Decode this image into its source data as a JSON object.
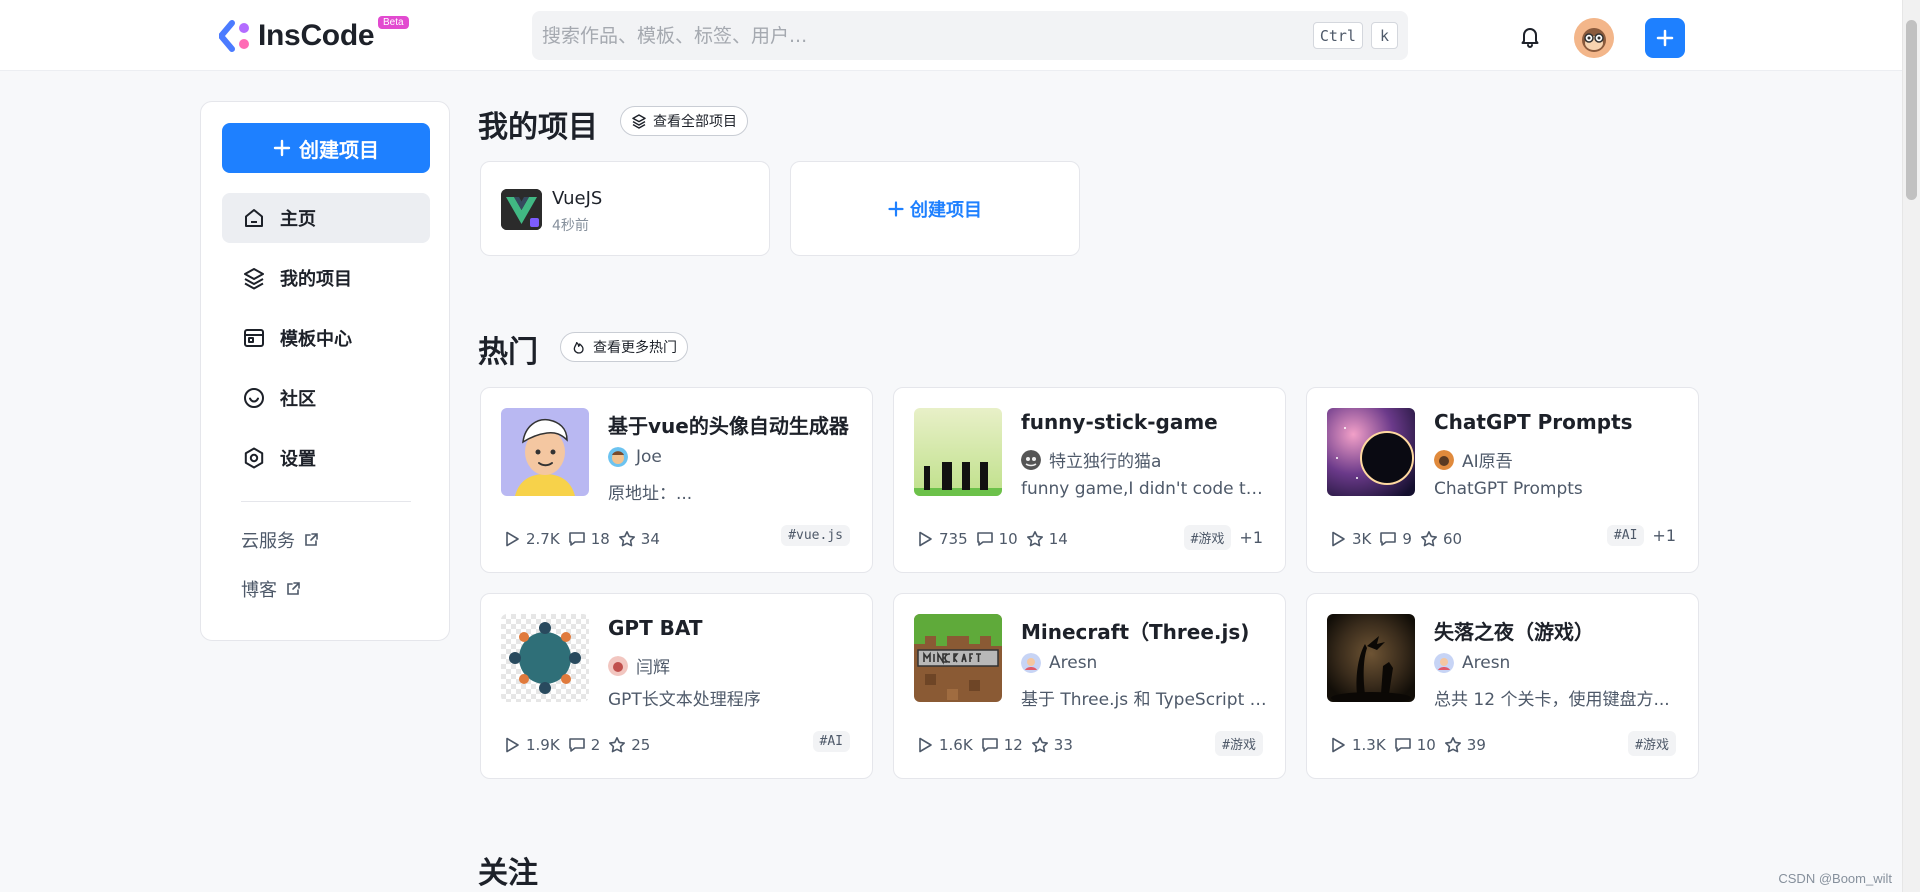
{
  "brand": {
    "name": "InsCode",
    "badge": "Beta",
    "color": "#1e80ff"
  },
  "search": {
    "placeholder": "搜索作品、模板、标签、用户...",
    "value": "",
    "shortcut_ctrl": "Ctrl",
    "shortcut_key": "k"
  },
  "sidebar": {
    "create_label": "创建项目",
    "items": [
      {
        "label": "主页",
        "icon": "home-icon",
        "active": true
      },
      {
        "label": "我的项目",
        "icon": "layers-icon",
        "active": false
      },
      {
        "label": "模板中心",
        "icon": "template-icon",
        "active": false
      },
      {
        "label": "社区",
        "icon": "community-icon",
        "active": false
      },
      {
        "label": "设置",
        "icon": "settings-icon",
        "active": false
      }
    ],
    "links": [
      {
        "label": "云服务",
        "icon": "external-link-icon"
      },
      {
        "label": "博客",
        "icon": "external-link-icon"
      }
    ]
  },
  "my_projects": {
    "title": "我的项目",
    "view_all": "查看全部项目",
    "projects": [
      {
        "name": "VueJS",
        "time": "4秒前"
      }
    ],
    "create_label": "创建项目"
  },
  "hot": {
    "title": "热门",
    "view_more": "查看更多热门",
    "cards": [
      {
        "title": "基于vue的头像自动生成器",
        "author": "Joe",
        "desc": "原地址：...",
        "runs": "2.7K",
        "comments": "18",
        "stars": "34",
        "tags": [
          "#vue.js"
        ],
        "more": ""
      },
      {
        "title": "funny-stick-game",
        "author": "特立独行的猫a",
        "desc": "funny game,I didn't code this...",
        "runs": "735",
        "comments": "10",
        "stars": "14",
        "tags": [
          "#游戏"
        ],
        "more": "+1"
      },
      {
        "title": "ChatGPT Prompts",
        "author": "AI原吾",
        "desc": "ChatGPT Prompts",
        "runs": "3K",
        "comments": "9",
        "stars": "60",
        "tags": [
          "#AI"
        ],
        "more": "+1"
      },
      {
        "title": "GPT BAT",
        "author": "闫辉",
        "desc": "GPT长文本处理程序",
        "runs": "1.9K",
        "comments": "2",
        "stars": "25",
        "tags": [
          "#AI"
        ],
        "more": ""
      },
      {
        "title": "Minecraft（Three.js)",
        "author": "Aresn",
        "desc": "基于 Three.js 和 TypeScript 的...",
        "runs": "1.6K",
        "comments": "12",
        "stars": "33",
        "tags": [
          "#游戏"
        ],
        "more": ""
      },
      {
        "title": "失落之夜（游戏）",
        "author": "Aresn",
        "desc": "总共 12 个关卡，使用键盘方...",
        "runs": "1.3K",
        "comments": "10",
        "stars": "39",
        "tags": [
          "#游戏"
        ],
        "more": ""
      }
    ]
  },
  "follow": {
    "title": "关注"
  },
  "watermark": "CSDN @Boom_wilt"
}
